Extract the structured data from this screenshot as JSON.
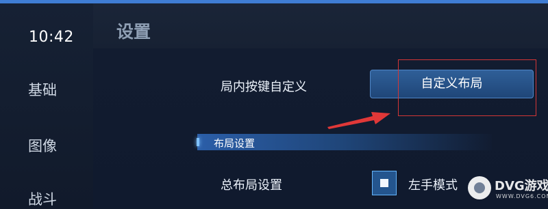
{
  "window": {
    "clock": "10:42",
    "title": "设置"
  },
  "sidebar": {
    "items": [
      {
        "label": "基础"
      },
      {
        "label": "图像"
      },
      {
        "label": "战斗"
      }
    ]
  },
  "settings": {
    "custom_keys_label": "局内按键自定义",
    "custom_layout_button": "自定义布局",
    "layout_section_title": "布局设置",
    "overall_layout_label": "总布局设置",
    "left_hand_mode_label": "左手模式",
    "left_hand_mode_checked": true
  },
  "annotations": {
    "highlight_color": "#d53636",
    "arrow_color": "#e03838"
  },
  "watermark": {
    "main": "DVG游戏网",
    "sub": "WWW.DVG6.COM"
  },
  "colors": {
    "accent": "#3f7dd4",
    "button_fill": "#2f5f98",
    "checkbox_fill": "#24558e"
  },
  "icons": {
    "annotation_arrow": "red-arrow-icon",
    "watermark_logo": "dvg-logo-icon",
    "checkbox_indicator": "checkbox-square-icon"
  }
}
